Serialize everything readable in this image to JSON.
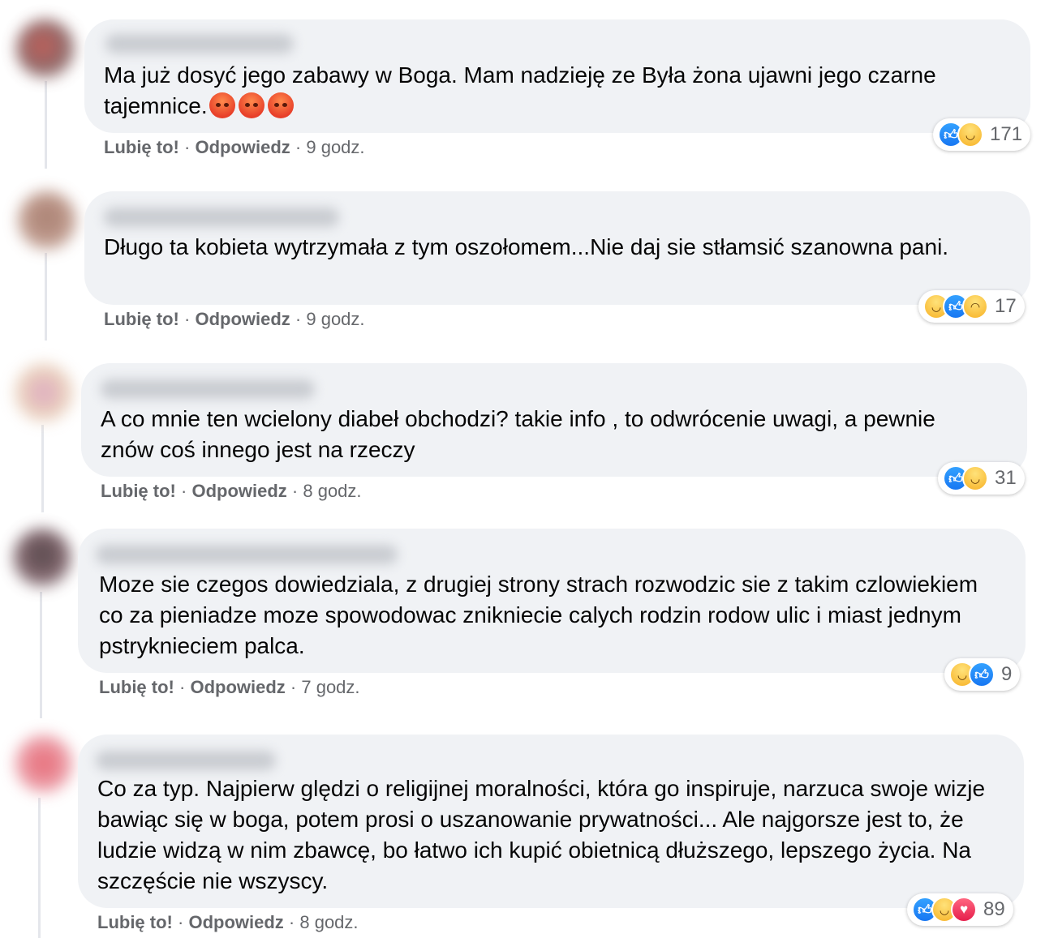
{
  "actions": {
    "like": "Lubię to!",
    "reply": "Odpowiedz",
    "sep": "·"
  },
  "comments": [
    {
      "text": "Ma już dosyć jego zabawy w Boga. Mam nadzieję ze Była żona ujawni jego czarne tajemnice.",
      "emoji": [
        "angry-face-icon",
        "angry-face-icon",
        "angry-face-icon"
      ],
      "time": "9 godz.",
      "reactions": [
        "like",
        "haha"
      ],
      "reaction_count": "171"
    },
    {
      "text": "Długo ta kobieta wytrzymała z tym oszołomem...Nie daj sie stłamsić szanowna pani.",
      "time": "9 godz.",
      "reactions": [
        "haha",
        "like",
        "sad"
      ],
      "reaction_count": "17"
    },
    {
      "text": "A co mnie ten wcielony diabeł obchodzi? takie info , to odwrócenie uwagi, a pewnie znów coś innego jest na rzeczy",
      "time": "8 godz.",
      "reactions": [
        "like",
        "haha"
      ],
      "reaction_count": "31"
    },
    {
      "text": "Moze sie czegos dowiedziala, z drugiej strony strach rozwodzic sie z takim czlowiekiem co za pieniadze moze spowodowac znikniecie calych rodzin rodow ulic i miast jednym pstryknieciem palca.",
      "time": "7 godz.",
      "reactions": [
        "haha",
        "like"
      ],
      "reaction_count": "9"
    },
    {
      "text": "Co za typ. Najpierw ględzi o religijnej moralności, która go inspiruje, narzuca swoje wizje bawiąc się w boga, potem prosi o uszanowanie prywatności... Ale najgorsze jest to, że ludzie widzą w nim zbawcę, bo łatwo ich kupić obietnicą dłuższego, lepszego życia. Na szczęście nie wszyscy.",
      "time": "8 godz.",
      "reactions": [
        "like",
        "haha",
        "love"
      ],
      "reaction_count": "89"
    }
  ],
  "colors": {
    "bubble": "#f0f2f5",
    "meta": "#65676b",
    "like": "#1877f2",
    "love": "#e61e4b",
    "haha": "#f7b125"
  }
}
